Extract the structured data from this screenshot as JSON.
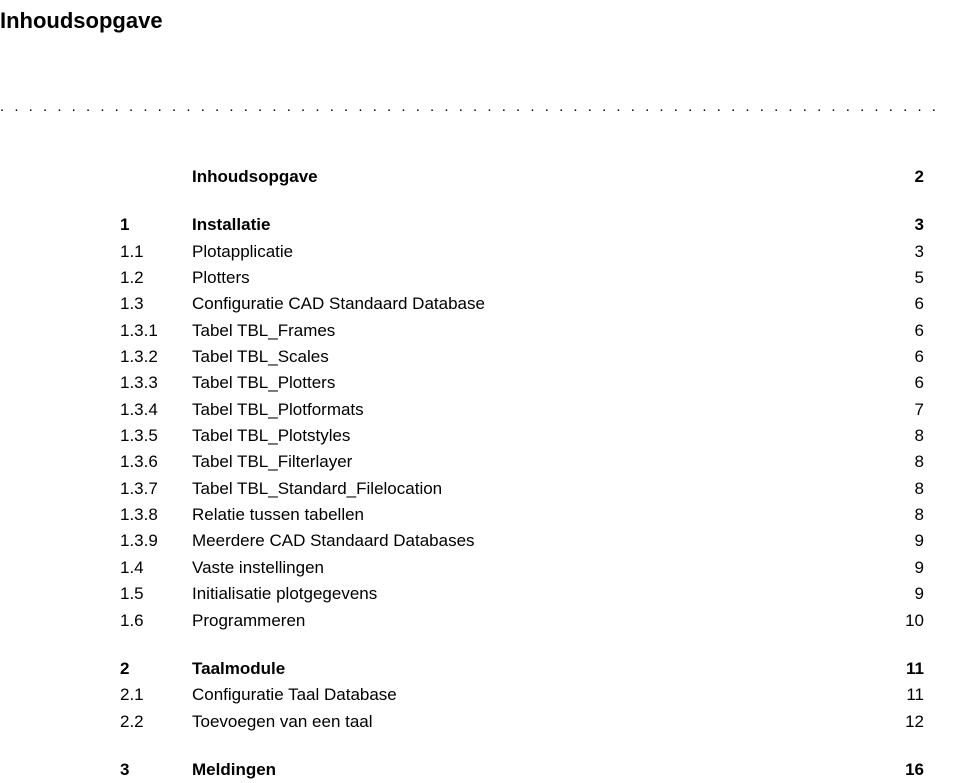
{
  "document": {
    "title": "Inhoudsopgave",
    "dotted_rule": ". . . . . . . . . . . . . . . . . . . . . . . . . . . . . . . . . . . . . . . . . . . . . . . . . . . . . . . . . . . . . . . . . . . . . . . . . . . . . . . . . . . . . . . . . . . . . . . . . . . ."
  },
  "toc": {
    "self": {
      "num": "",
      "label": "Inhoudsopgave",
      "page": "2"
    },
    "sections": [
      {
        "num": "1",
        "label": "Installatie",
        "page": "3",
        "items": [
          {
            "num": "1.1",
            "label": "Plotapplicatie",
            "page": "3"
          },
          {
            "num": "1.2",
            "label": "Plotters",
            "page": "5"
          },
          {
            "num": "1.3",
            "label": "Configuratie CAD Standaard Database",
            "page": "6"
          },
          {
            "num": "1.3.1",
            "label": "Tabel TBL_Frames",
            "page": "6"
          },
          {
            "num": "1.3.2",
            "label": "Tabel TBL_Scales",
            "page": "6"
          },
          {
            "num": "1.3.3",
            "label": "Tabel TBL_Plotters",
            "page": "6"
          },
          {
            "num": "1.3.4",
            "label": "Tabel TBL_Plotformats",
            "page": "7"
          },
          {
            "num": "1.3.5",
            "label": "Tabel TBL_Plotstyles",
            "page": "8"
          },
          {
            "num": "1.3.6",
            "label": "Tabel TBL_Filterlayer",
            "page": "8"
          },
          {
            "num": "1.3.7",
            "label": "Tabel TBL_Standard_Filelocation",
            "page": "8"
          },
          {
            "num": "1.3.8",
            "label": "Relatie tussen tabellen",
            "page": "8"
          },
          {
            "num": "1.3.9",
            "label": "Meerdere CAD Standaard Databases",
            "page": "9"
          },
          {
            "num": "1.4",
            "label": "Vaste instellingen",
            "page": "9"
          },
          {
            "num": "1.5",
            "label": "Initialisatie plotgegevens",
            "page": "9"
          },
          {
            "num": "1.6",
            "label": "Programmeren",
            "page": "10"
          }
        ]
      },
      {
        "num": "2",
        "label": "Taalmodule",
        "page": "11",
        "items": [
          {
            "num": "2.1",
            "label": "Configuratie Taal Database",
            "page": "11"
          },
          {
            "num": "2.2",
            "label": "Toevoegen van een taal",
            "page": "12"
          }
        ]
      },
      {
        "num": "3",
        "label": "Meldingen",
        "page": "16",
        "items": []
      }
    ]
  }
}
